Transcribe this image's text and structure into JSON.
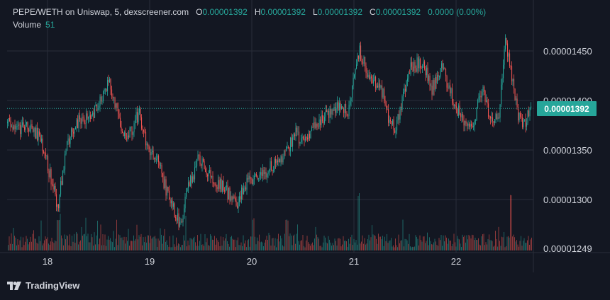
{
  "header": {
    "pair": "PEPE/WETH on Uniswap, 5, dexscreener.com",
    "open_label": "O",
    "open": "0.00001392",
    "high_label": "H",
    "high": "0.00001392",
    "low_label": "L",
    "low": "0.00001392",
    "close_label": "C",
    "close": "0.00001392",
    "change": "0.0000 (0.00%)",
    "volume_label": "Volume",
    "volume": "51"
  },
  "price_tag": "0.00001392",
  "brand": "TradingView",
  "colors": {
    "background": "#131722",
    "up": "#26a69a",
    "down": "#ef5350",
    "grid": "#2a2e39",
    "text": "#d1d4dc"
  },
  "chart_data": {
    "type": "candlestick",
    "title": "PEPE/WETH on Uniswap, 5, dexscreener.com",
    "x_tick_labels": [
      "18",
      "19",
      "20",
      "21",
      "22"
    ],
    "y_tick_labels": [
      "0.00001450",
      "0.00001400",
      "0.00001350",
      "0.00001300",
      "0.00001249"
    ],
    "ylim": [
      1.249e-05,
      1.47e-05
    ],
    "last_price": 1.392e-05,
    "grid": true,
    "series": [
      {
        "name": "Price",
        "anchor_days": [
          17.59,
          17.7,
          17.8,
          17.93,
          18.1,
          18.18,
          18.26,
          18.33,
          18.44,
          18.6,
          18.69,
          18.78,
          18.89,
          18.98,
          19.07,
          19.17,
          19.3,
          19.37,
          19.48,
          19.62,
          19.72,
          19.85,
          19.96,
          20.08,
          20.22,
          20.33,
          20.42,
          20.5,
          20.62,
          20.75,
          20.85,
          20.94,
          21.05,
          21.14,
          21.27,
          21.33,
          21.4,
          21.55,
          21.66,
          21.76,
          21.86,
          21.95,
          22.06,
          22.16,
          22.26,
          22.33,
          22.42,
          22.48,
          22.55,
          22.61,
          22.66,
          22.74
        ],
        "anchor_prices": [
          1.378e-05,
          1.37e-05,
          1.374e-05,
          1.362e-05,
          1.292e-05,
          1.355e-05,
          1.376e-05,
          1.38e-05,
          1.385e-05,
          1.42e-05,
          1.38e-05,
          1.36e-05,
          1.388e-05,
          1.35e-05,
          1.34e-05,
          1.305e-05,
          1.275e-05,
          1.31e-05,
          1.342e-05,
          1.318e-05,
          1.312e-05,
          1.296e-05,
          1.318e-05,
          1.322e-05,
          1.336e-05,
          1.345e-05,
          1.368e-05,
          1.358e-05,
          1.378e-05,
          1.388e-05,
          1.395e-05,
          1.39e-05,
          1.45e-05,
          1.425e-05,
          1.41e-05,
          1.385e-05,
          1.37e-05,
          1.432e-05,
          1.44e-05,
          1.412e-05,
          1.435e-05,
          1.405e-05,
          1.38e-05,
          1.372e-05,
          1.418e-05,
          1.375e-05,
          1.39e-05,
          1.462e-05,
          1.418e-05,
          1.382e-05,
          1.375e-05,
          1.392e-05
        ]
      }
    ],
    "volume": {
      "name": "Volume",
      "last": 51,
      "spikes": [
        {
          "day": 21.04,
          "level": 1.0
        },
        {
          "day": 22.53,
          "level": 0.9
        },
        {
          "day": 18.1,
          "level": 0.55
        },
        {
          "day": 20.34,
          "level": 0.5
        }
      ]
    }
  }
}
